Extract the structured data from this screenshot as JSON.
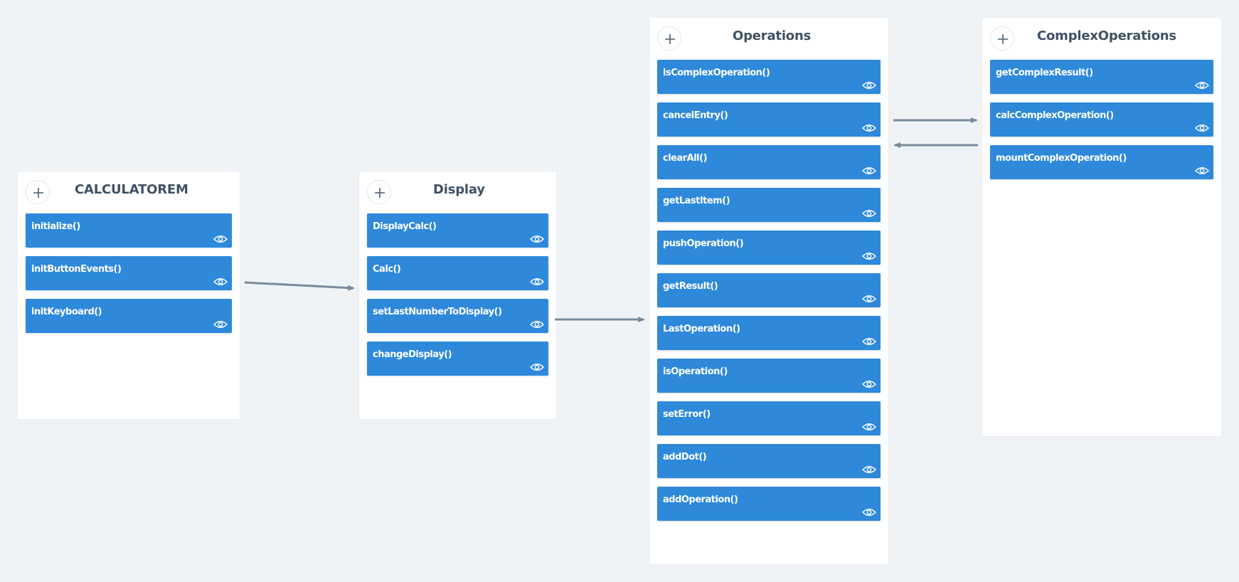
{
  "classes": [
    {
      "title": "CALCULATOREM",
      "methods": [
        "initialize()",
        "initButtonEvents()",
        "initKeyboard()"
      ]
    },
    {
      "title": "Display",
      "methods": [
        "DisplayCalc()",
        "Calc()",
        "setLastNumberToDisplay()",
        "changeDisplay()"
      ]
    },
    {
      "title": "Operations",
      "methods": [
        "isComplexOperation()",
        "cancelEntry()",
        "clearAll()",
        "getLastItem()",
        "pushOperation()",
        "getResult()",
        "LastOperation()",
        "isOperation()",
        "setError()",
        "addDot()",
        "addOperation()"
      ]
    },
    {
      "title": "ComplexOperations",
      "methods": [
        "getComplexResult()",
        "calcComplexOperation()",
        "mountComplexOperation()"
      ]
    }
  ],
  "colors": {
    "background": "#eff3f6",
    "method_fill": "#2e89db",
    "title_text": "#3f5166",
    "arrow": "#7a8a9a"
  },
  "icons": {
    "add": "plus-icon",
    "view": "eye-icon"
  }
}
